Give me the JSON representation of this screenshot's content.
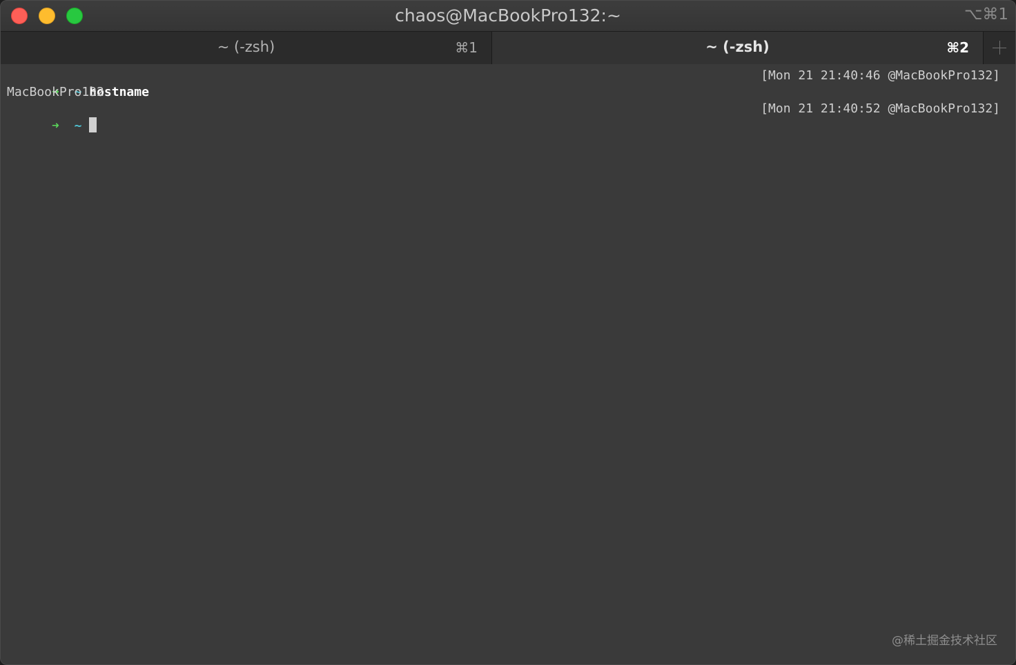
{
  "window": {
    "title": "chaos@MacBookPro132:~",
    "shortcut": "⌥⌘1"
  },
  "tabs": [
    {
      "label": "~ (-zsh)",
      "shortcut": "⌘1",
      "active": false
    },
    {
      "label": "~ (-zsh)",
      "shortcut": "⌘2",
      "active": true
    }
  ],
  "new_tab_label": "+",
  "terminal": {
    "prompt_arrow": "➜",
    "prompt_dir": "~",
    "lines": [
      {
        "command": "hostname",
        "right_prompt": "[Mon 21 21:40:46 @MacBookPro132]"
      },
      {
        "output": "MacBookPro132"
      },
      {
        "command": "",
        "right_prompt": "[Mon 21 21:40:52 @MacBookPro132]"
      }
    ]
  },
  "watermark": "@稀土掘金技术社区",
  "colors": {
    "close": "#fe5f57",
    "minimize": "#febc2e",
    "zoom": "#28c840",
    "prompt_arrow": "#5ad25a",
    "prompt_dir": "#4fc1d1",
    "background": "#3a3a3a"
  }
}
